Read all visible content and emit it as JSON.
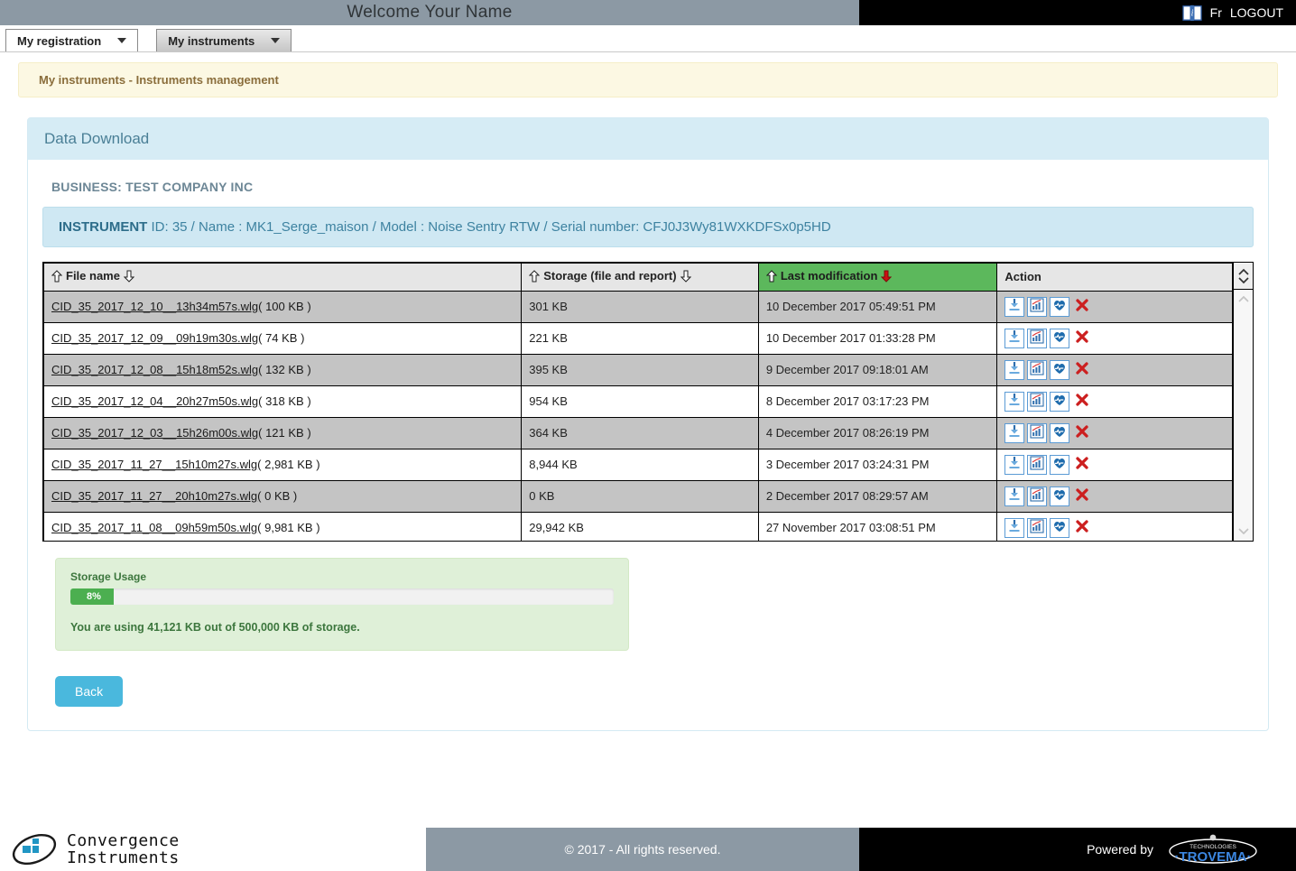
{
  "topbar": {
    "welcome": "Welcome  Your Name",
    "info_icon": "book-info-icon",
    "lang": "Fr",
    "logout": "LOGOUT"
  },
  "nav": {
    "tabs": [
      {
        "label": "My registration",
        "active": false
      },
      {
        "label": "My instruments",
        "active": true
      }
    ]
  },
  "alert": {
    "text": "My instruments - Instruments management"
  },
  "panel": {
    "title": "Data Download",
    "business_label": "BUSINESS: TEST COMPANY INC",
    "instrument": {
      "prefix": "INSTRUMENT",
      "details": " ID: 35 / Name : MK1_Serge_maison / Model : Noise Sentry RTW / Serial number: CFJ0J3Wy81WXKDFSx0p5HD"
    }
  },
  "table": {
    "columns": [
      {
        "label": "File name",
        "sorted": false
      },
      {
        "label": "Storage (file and report)",
        "sorted": false
      },
      {
        "label": "Last modification",
        "sorted": true
      },
      {
        "label": "Action",
        "sorted": false
      }
    ],
    "rows": [
      {
        "file": "CID_35_2017_12_10__13h34m57s.wlg",
        "size": "( 100 KB )",
        "storage": "301 KB",
        "modified": "10 December 2017 05:49:51 PM"
      },
      {
        "file": "CID_35_2017_12_09__09h19m30s.wlg",
        "size": "( 74 KB )",
        "storage": "221 KB",
        "modified": "10 December 2017 01:33:28 PM"
      },
      {
        "file": "CID_35_2017_12_08__15h18m52s.wlg",
        "size": "( 132 KB )",
        "storage": "395 KB",
        "modified": "9 December 2017 09:18:01 AM"
      },
      {
        "file": "CID_35_2017_12_04__20h27m50s.wlg",
        "size": "( 318 KB )",
        "storage": "954 KB",
        "modified": "8 December 2017 03:17:23 PM"
      },
      {
        "file": "CID_35_2017_12_03__15h26m00s.wlg",
        "size": "( 121 KB )",
        "storage": "364 KB",
        "modified": "4 December 2017 08:26:19 PM"
      },
      {
        "file": "CID_35_2017_11_27__15h10m27s.wlg",
        "size": "( 2,981 KB )",
        "storage": "8,944 KB",
        "modified": "3 December 2017 03:24:31 PM"
      },
      {
        "file": "CID_35_2017_11_27__20h10m27s.wlg",
        "size": "( 0 KB )",
        "storage": "0 KB",
        "modified": "2 December 2017 08:29:57 AM"
      },
      {
        "file": "CID_35_2017_11_08__09h59m50s.wlg",
        "size": "( 9,981 KB )",
        "storage": "29,942 KB",
        "modified": "27 November 2017 03:08:51 PM"
      }
    ],
    "action_icons": [
      "download-icon",
      "chart-icon",
      "heartbeat-icon",
      "delete-icon"
    ]
  },
  "storage": {
    "title": "Storage Usage",
    "percent_label": "8%",
    "percent_value": 8,
    "note": "You are using 41,121 KB out of 500,000 KB of storage."
  },
  "buttons": {
    "back": "Back"
  },
  "footer": {
    "brand_line1": "Convergence",
    "brand_line2": "Instruments",
    "copyright": "© 2017 - All rights reserved.",
    "powered_by": "Powered by",
    "partner_small": "TECHNOLOGIES",
    "partner_name": "TROVEMA"
  },
  "colors": {
    "topbar_gray": "#8c99a4",
    "accent_blue": "#4ab8dd",
    "sorted_green": "#5cb85c",
    "progress_green": "#4caf50",
    "alert_yellow": "#fcf8e3"
  }
}
